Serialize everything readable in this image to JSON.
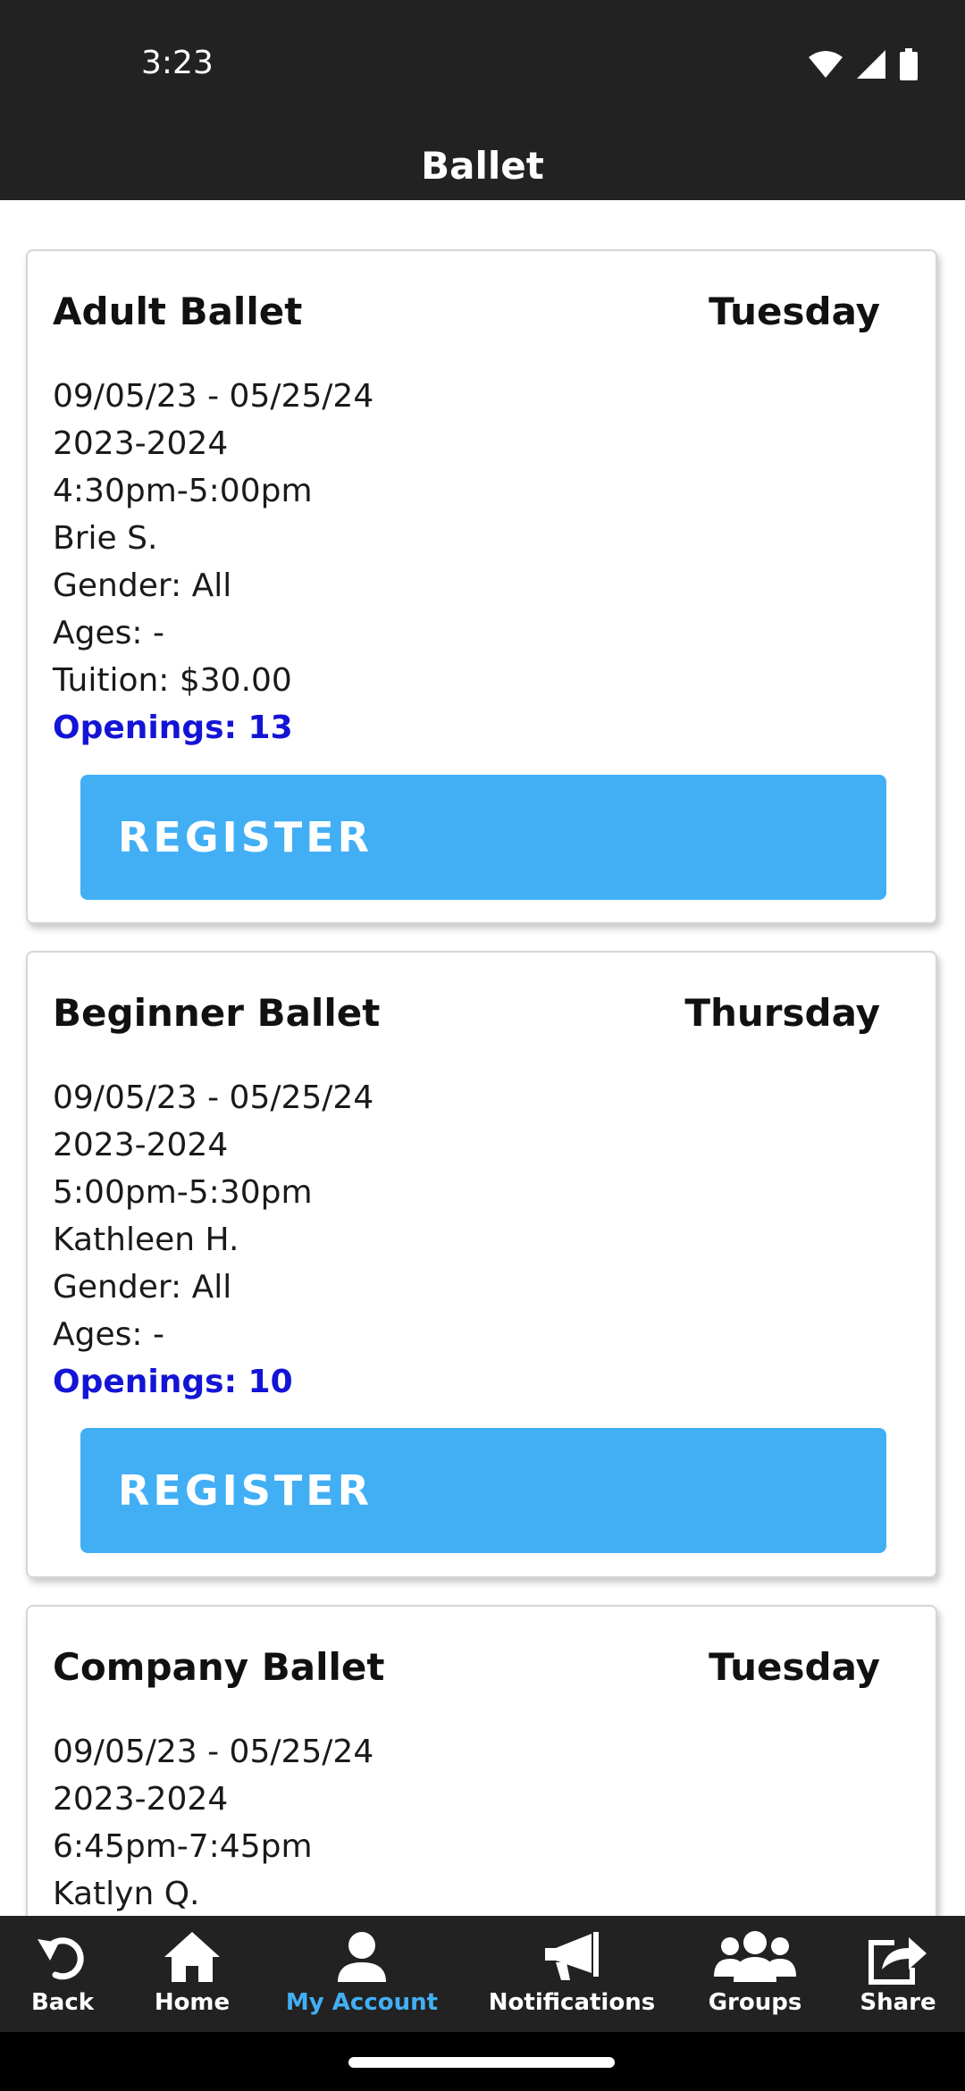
{
  "status_bar": {
    "time": "3:23",
    "icons": [
      "wifi-icon",
      "signal-icon",
      "battery-icon"
    ]
  },
  "header": {
    "title": "Ballet"
  },
  "classes": [
    {
      "name": "Adult Ballet",
      "day": "Tuesday",
      "dates": "09/05/23 - 05/25/24",
      "season": "2023-2024",
      "time": "4:30pm-5:00pm",
      "instructor": "Brie S.",
      "gender": "Gender: All",
      "ages": "Ages: -",
      "tuition": "Tuition: $30.00",
      "openings": "Openings: 13",
      "button": "REGISTER"
    },
    {
      "name": "Beginner Ballet",
      "day": "Thursday",
      "dates": "09/05/23 - 05/25/24",
      "season": "2023-2024",
      "time": "5:00pm-5:30pm",
      "instructor": "Kathleen H.",
      "gender": "Gender: All",
      "ages": "Ages: -",
      "openings": "Openings: 10",
      "button": "REGISTER"
    },
    {
      "name": "Company Ballet",
      "day": "Tuesday",
      "dates": "09/05/23 - 05/25/24",
      "season": "2023-2024",
      "time": "6:45pm-7:45pm",
      "instructor": "Katlyn Q."
    }
  ],
  "nav": {
    "active": "My Account",
    "items": [
      {
        "label": "Back",
        "icon": "back-icon"
      },
      {
        "label": "Home",
        "icon": "home-icon"
      },
      {
        "label": "My Account",
        "icon": "account-icon"
      },
      {
        "label": "Notifications",
        "icon": "megaphone-icon"
      },
      {
        "label": "Groups",
        "icon": "groups-icon"
      },
      {
        "label": "Share",
        "icon": "share-icon"
      }
    ]
  },
  "colors": {
    "header_bg": "#222222",
    "register_button": "#42aff5",
    "openings_text": "#1414d6",
    "nav_active": "#42aff5"
  }
}
